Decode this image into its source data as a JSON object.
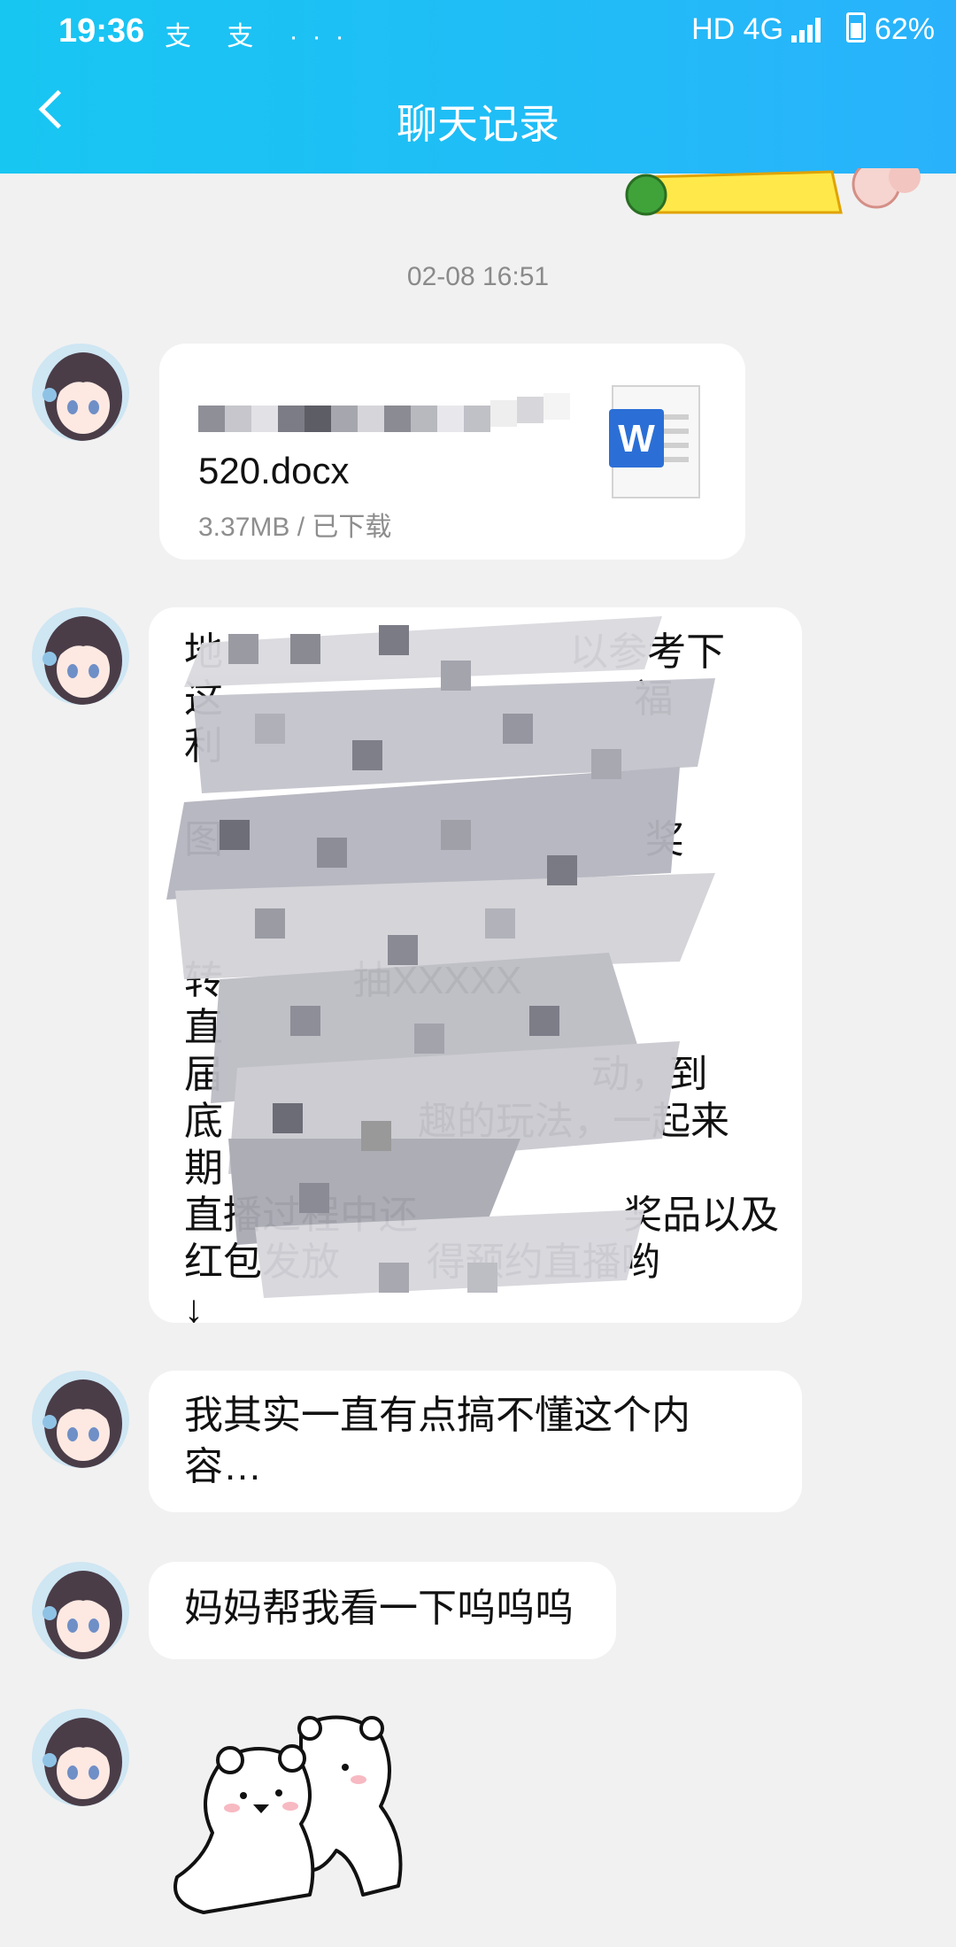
{
  "status_bar": {
    "time": "19:36",
    "left_icons": "支 支 ···",
    "right_text": "HD 4G",
    "battery": "62%"
  },
  "header": {
    "title": "聊天记录"
  },
  "chat": {
    "timestamp": "02-08 16:51",
    "file_message": {
      "file_name": "520.docx",
      "file_meta": "3.37MB / 已下载",
      "icon": "word-doc-icon"
    },
    "long_message_lines": [
      "地                                以参考下",
      "这                                      福",
      "利                                          ",
      "                                            ",
      "图                                       奖",
      "                                            ",
      "                                            ",
      "转            抽XXXXX                       ",
      "直                                          ",
      "届                                  动，到",
      "底                  趣的玩法，一起来",
      "期                                          ",
      "直播过程中还                   奖品以及",
      "红包发放        得预约直播哟",
      "↓                                           "
    ],
    "msg3": "我其实一直有点搞不懂这个内容…",
    "msg4": "妈妈帮我看一下呜呜呜"
  },
  "colors": {
    "header": "#20bdf6",
    "background": "#f1f1f1",
    "bubble": "#ffffff",
    "word_blue": "#2b6fd6"
  }
}
